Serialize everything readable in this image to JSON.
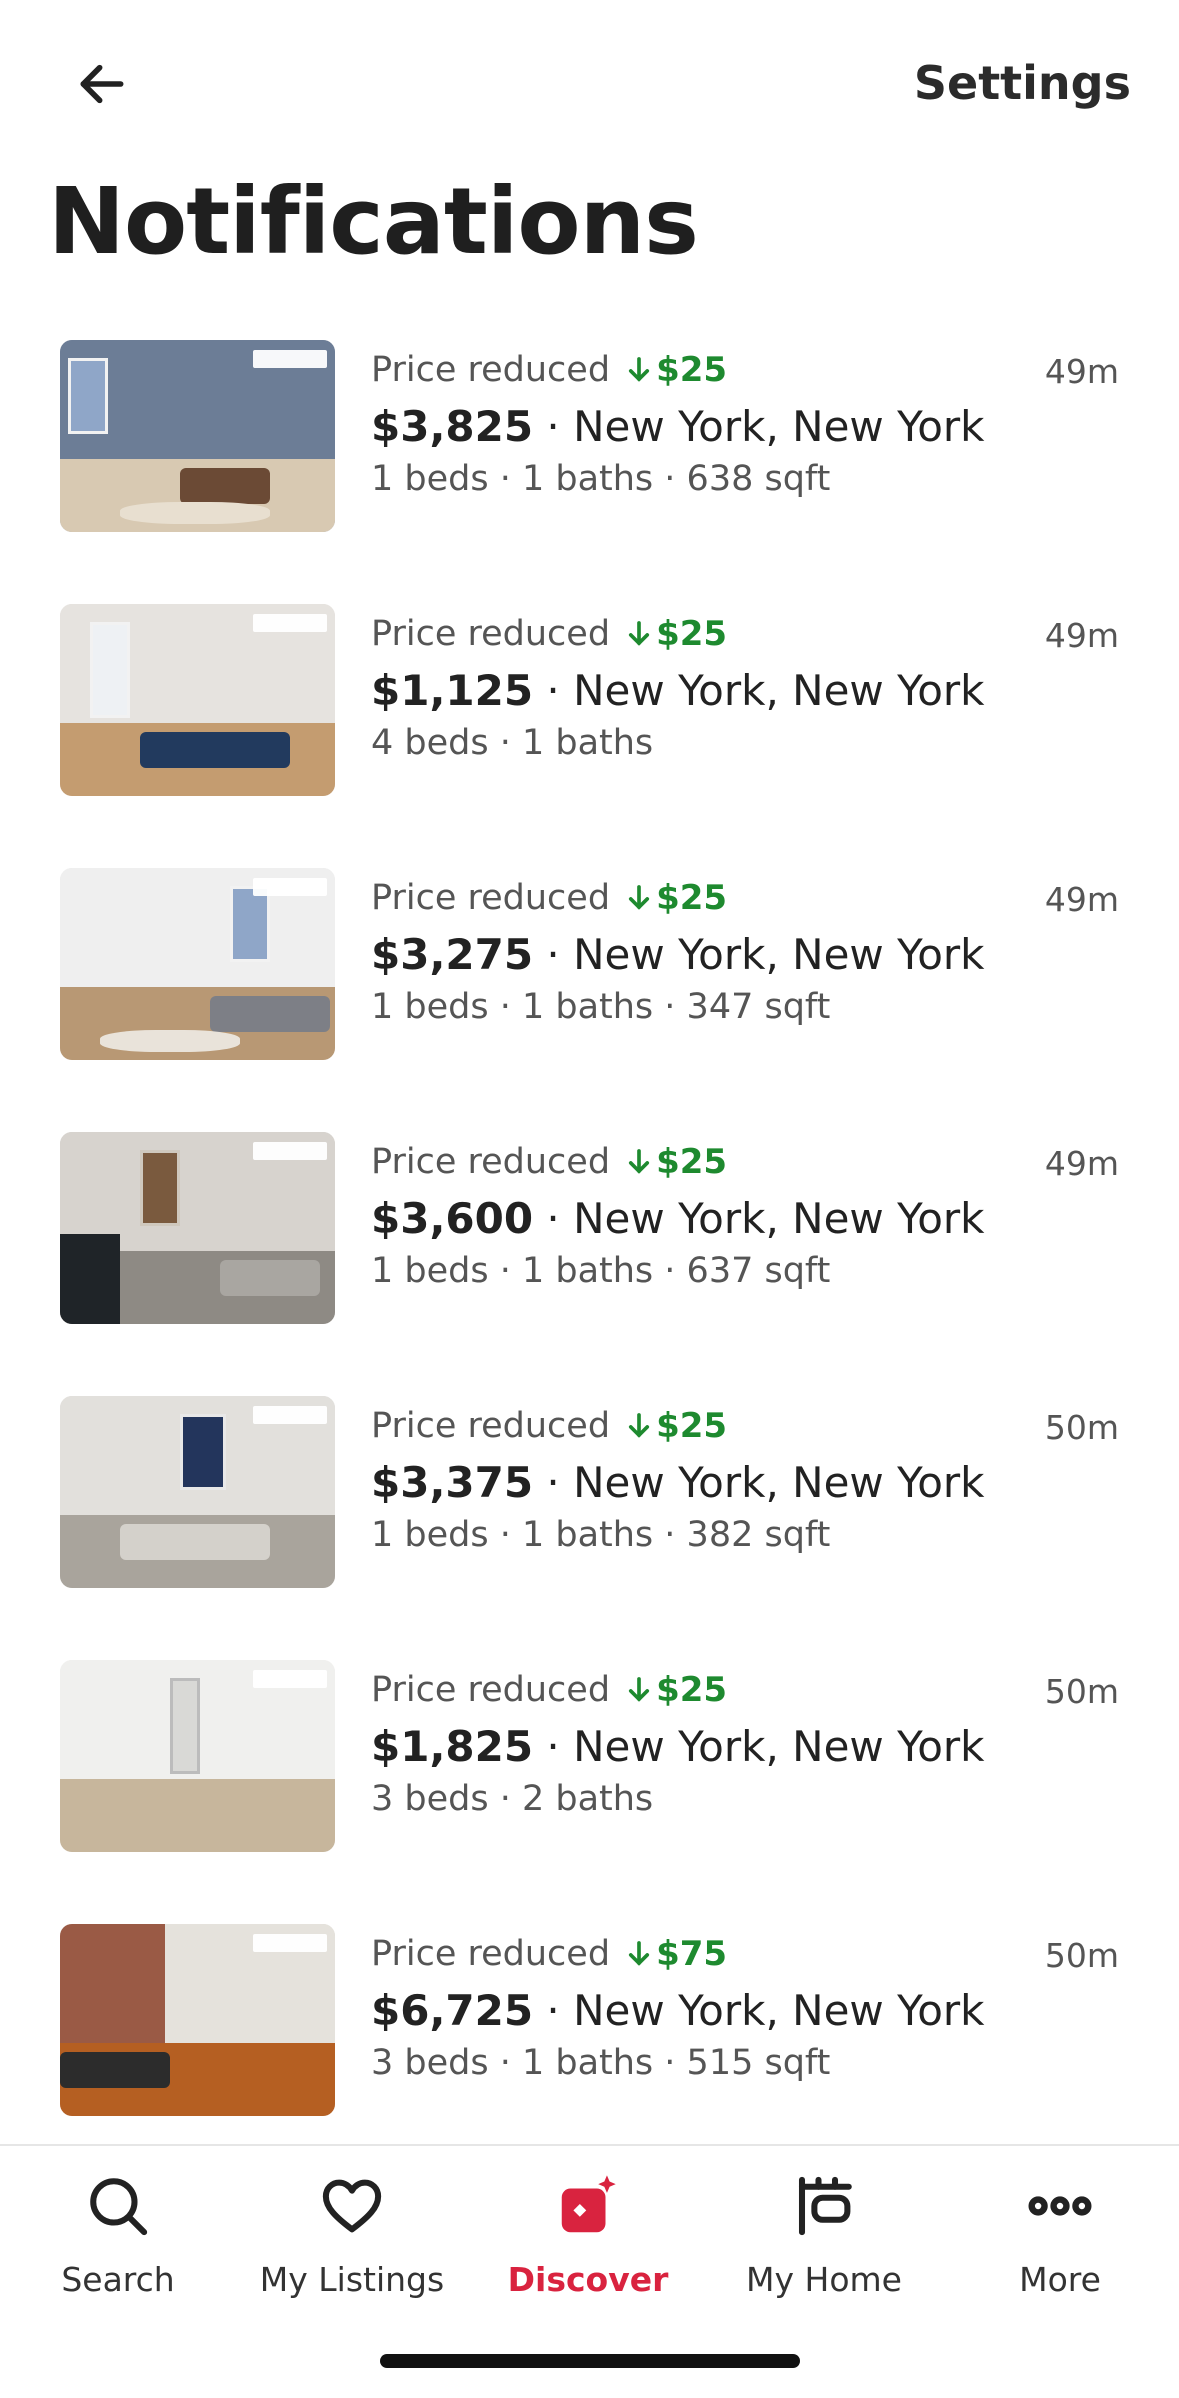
{
  "header": {
    "settings_label": "Settings",
    "title": "Notifications",
    "back_icon": "arrow-left-icon"
  },
  "colors": {
    "accent_red": "#d9233f",
    "price_drop_green": "#1e8a2f",
    "text_dark": "#222222",
    "text_muted": "#555555"
  },
  "notifications": [
    {
      "type": "Price reduced",
      "drop": "$25",
      "price": "$3,825",
      "location": "New York, New York",
      "details": "1 beds · 1 baths · 638 sqft",
      "time": "49m"
    },
    {
      "type": "Price reduced",
      "drop": "$25",
      "price": "$1,125",
      "location": "New York, New York",
      "details": "4 beds · 1 baths",
      "time": "49m"
    },
    {
      "type": "Price reduced",
      "drop": "$25",
      "price": "$3,275",
      "location": "New York, New York",
      "details": "1 beds · 1 baths · 347 sqft",
      "time": "49m"
    },
    {
      "type": "Price reduced",
      "drop": "$25",
      "price": "$3,600",
      "location": "New York, New York",
      "details": "1 beds · 1 baths · 637 sqft",
      "time": "49m"
    },
    {
      "type": "Price reduced",
      "drop": "$25",
      "price": "$3,375",
      "location": "New York, New York",
      "details": "1 beds · 1 baths · 382 sqft",
      "time": "50m"
    },
    {
      "type": "Price reduced",
      "drop": "$25",
      "price": "$1,825",
      "location": "New York, New York",
      "details": "3 beds · 2 baths",
      "time": "50m"
    },
    {
      "type": "Price reduced",
      "drop": "$75",
      "price": "$6,725",
      "location": "New York, New York",
      "details": "3 beds · 1 baths · 515 sqft",
      "time": "50m"
    }
  ],
  "tabbar": {
    "tabs": [
      {
        "label": "Search",
        "icon": "search-icon"
      },
      {
        "label": "My Listings",
        "icon": "heart-icon"
      },
      {
        "label": "Discover",
        "icon": "discover-icon",
        "active": true
      },
      {
        "label": "My Home",
        "icon": "home-sign-icon"
      },
      {
        "label": "More",
        "icon": "more-dots-icon"
      }
    ]
  }
}
